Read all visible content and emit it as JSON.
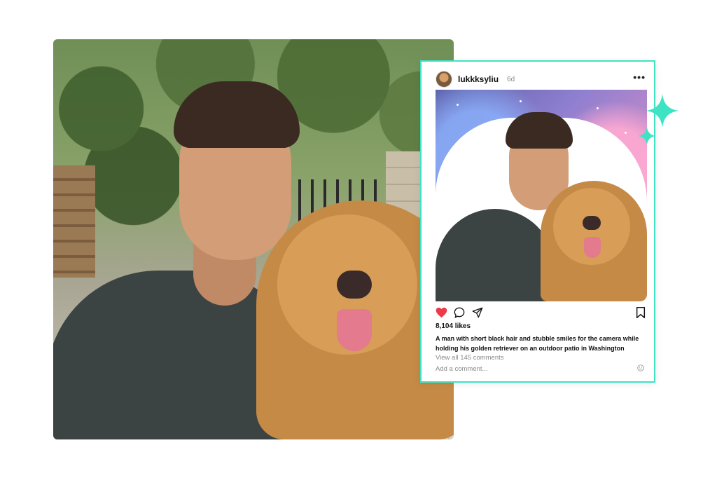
{
  "post": {
    "username": "lukkksyliu",
    "age": "6d",
    "more_icon": "more-horizontal-icon",
    "likes": "8,104 likes",
    "caption": "A man with short black hair and stubble smiles for the camera while holding his golden retriever on an outdoor patio in Washington",
    "view_comments": "View all 145 comments",
    "comment_placeholder": "Add a comment...",
    "actions": {
      "like_icon": "heart-icon",
      "comment_icon": "comment-icon",
      "share_icon": "send-icon",
      "save_icon": "bookmark-icon",
      "emoji_icon": "smiley-icon",
      "liked": true
    }
  },
  "colors": {
    "accent": "#3ee3c4",
    "like": "#ed3a48",
    "muted_text": "#8a8a8a",
    "text": "#111111"
  },
  "decor": {
    "sparkle_icon": "sparkle-icon"
  }
}
